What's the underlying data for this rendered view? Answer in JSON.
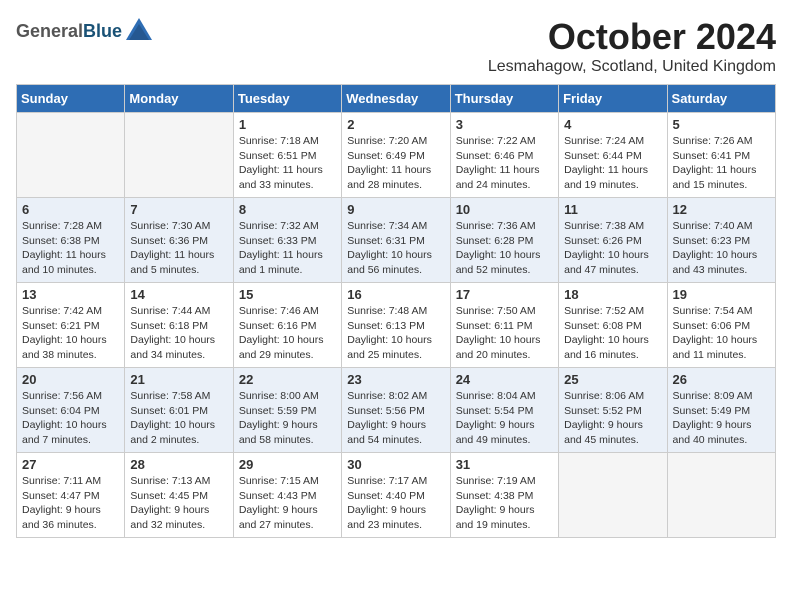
{
  "header": {
    "logo_general": "General",
    "logo_blue": "Blue",
    "month_title": "October 2024",
    "location": "Lesmahagow, Scotland, United Kingdom"
  },
  "weekdays": [
    "Sunday",
    "Monday",
    "Tuesday",
    "Wednesday",
    "Thursday",
    "Friday",
    "Saturday"
  ],
  "weeks": [
    [
      {
        "day": "",
        "empty": true
      },
      {
        "day": "",
        "empty": true
      },
      {
        "day": "1",
        "sunrise": "Sunrise: 7:18 AM",
        "sunset": "Sunset: 6:51 PM",
        "daylight": "Daylight: 11 hours and 33 minutes."
      },
      {
        "day": "2",
        "sunrise": "Sunrise: 7:20 AM",
        "sunset": "Sunset: 6:49 PM",
        "daylight": "Daylight: 11 hours and 28 minutes."
      },
      {
        "day": "3",
        "sunrise": "Sunrise: 7:22 AM",
        "sunset": "Sunset: 6:46 PM",
        "daylight": "Daylight: 11 hours and 24 minutes."
      },
      {
        "day": "4",
        "sunrise": "Sunrise: 7:24 AM",
        "sunset": "Sunset: 6:44 PM",
        "daylight": "Daylight: 11 hours and 19 minutes."
      },
      {
        "day": "5",
        "sunrise": "Sunrise: 7:26 AM",
        "sunset": "Sunset: 6:41 PM",
        "daylight": "Daylight: 11 hours and 15 minutes."
      }
    ],
    [
      {
        "day": "6",
        "sunrise": "Sunrise: 7:28 AM",
        "sunset": "Sunset: 6:38 PM",
        "daylight": "Daylight: 11 hours and 10 minutes."
      },
      {
        "day": "7",
        "sunrise": "Sunrise: 7:30 AM",
        "sunset": "Sunset: 6:36 PM",
        "daylight": "Daylight: 11 hours and 5 minutes."
      },
      {
        "day": "8",
        "sunrise": "Sunrise: 7:32 AM",
        "sunset": "Sunset: 6:33 PM",
        "daylight": "Daylight: 11 hours and 1 minute."
      },
      {
        "day": "9",
        "sunrise": "Sunrise: 7:34 AM",
        "sunset": "Sunset: 6:31 PM",
        "daylight": "Daylight: 10 hours and 56 minutes."
      },
      {
        "day": "10",
        "sunrise": "Sunrise: 7:36 AM",
        "sunset": "Sunset: 6:28 PM",
        "daylight": "Daylight: 10 hours and 52 minutes."
      },
      {
        "day": "11",
        "sunrise": "Sunrise: 7:38 AM",
        "sunset": "Sunset: 6:26 PM",
        "daylight": "Daylight: 10 hours and 47 minutes."
      },
      {
        "day": "12",
        "sunrise": "Sunrise: 7:40 AM",
        "sunset": "Sunset: 6:23 PM",
        "daylight": "Daylight: 10 hours and 43 minutes."
      }
    ],
    [
      {
        "day": "13",
        "sunrise": "Sunrise: 7:42 AM",
        "sunset": "Sunset: 6:21 PM",
        "daylight": "Daylight: 10 hours and 38 minutes."
      },
      {
        "day": "14",
        "sunrise": "Sunrise: 7:44 AM",
        "sunset": "Sunset: 6:18 PM",
        "daylight": "Daylight: 10 hours and 34 minutes."
      },
      {
        "day": "15",
        "sunrise": "Sunrise: 7:46 AM",
        "sunset": "Sunset: 6:16 PM",
        "daylight": "Daylight: 10 hours and 29 minutes."
      },
      {
        "day": "16",
        "sunrise": "Sunrise: 7:48 AM",
        "sunset": "Sunset: 6:13 PM",
        "daylight": "Daylight: 10 hours and 25 minutes."
      },
      {
        "day": "17",
        "sunrise": "Sunrise: 7:50 AM",
        "sunset": "Sunset: 6:11 PM",
        "daylight": "Daylight: 10 hours and 20 minutes."
      },
      {
        "day": "18",
        "sunrise": "Sunrise: 7:52 AM",
        "sunset": "Sunset: 6:08 PM",
        "daylight": "Daylight: 10 hours and 16 minutes."
      },
      {
        "day": "19",
        "sunrise": "Sunrise: 7:54 AM",
        "sunset": "Sunset: 6:06 PM",
        "daylight": "Daylight: 10 hours and 11 minutes."
      }
    ],
    [
      {
        "day": "20",
        "sunrise": "Sunrise: 7:56 AM",
        "sunset": "Sunset: 6:04 PM",
        "daylight": "Daylight: 10 hours and 7 minutes."
      },
      {
        "day": "21",
        "sunrise": "Sunrise: 7:58 AM",
        "sunset": "Sunset: 6:01 PM",
        "daylight": "Daylight: 10 hours and 2 minutes."
      },
      {
        "day": "22",
        "sunrise": "Sunrise: 8:00 AM",
        "sunset": "Sunset: 5:59 PM",
        "daylight": "Daylight: 9 hours and 58 minutes."
      },
      {
        "day": "23",
        "sunrise": "Sunrise: 8:02 AM",
        "sunset": "Sunset: 5:56 PM",
        "daylight": "Daylight: 9 hours and 54 minutes."
      },
      {
        "day": "24",
        "sunrise": "Sunrise: 8:04 AM",
        "sunset": "Sunset: 5:54 PM",
        "daylight": "Daylight: 9 hours and 49 minutes."
      },
      {
        "day": "25",
        "sunrise": "Sunrise: 8:06 AM",
        "sunset": "Sunset: 5:52 PM",
        "daylight": "Daylight: 9 hours and 45 minutes."
      },
      {
        "day": "26",
        "sunrise": "Sunrise: 8:09 AM",
        "sunset": "Sunset: 5:49 PM",
        "daylight": "Daylight: 9 hours and 40 minutes."
      }
    ],
    [
      {
        "day": "27",
        "sunrise": "Sunrise: 7:11 AM",
        "sunset": "Sunset: 4:47 PM",
        "daylight": "Daylight: 9 hours and 36 minutes."
      },
      {
        "day": "28",
        "sunrise": "Sunrise: 7:13 AM",
        "sunset": "Sunset: 4:45 PM",
        "daylight": "Daylight: 9 hours and 32 minutes."
      },
      {
        "day": "29",
        "sunrise": "Sunrise: 7:15 AM",
        "sunset": "Sunset: 4:43 PM",
        "daylight": "Daylight: 9 hours and 27 minutes."
      },
      {
        "day": "30",
        "sunrise": "Sunrise: 7:17 AM",
        "sunset": "Sunset: 4:40 PM",
        "daylight": "Daylight: 9 hours and 23 minutes."
      },
      {
        "day": "31",
        "sunrise": "Sunrise: 7:19 AM",
        "sunset": "Sunset: 4:38 PM",
        "daylight": "Daylight: 9 hours and 19 minutes."
      },
      {
        "day": "",
        "empty": true
      },
      {
        "day": "",
        "empty": true
      }
    ]
  ]
}
